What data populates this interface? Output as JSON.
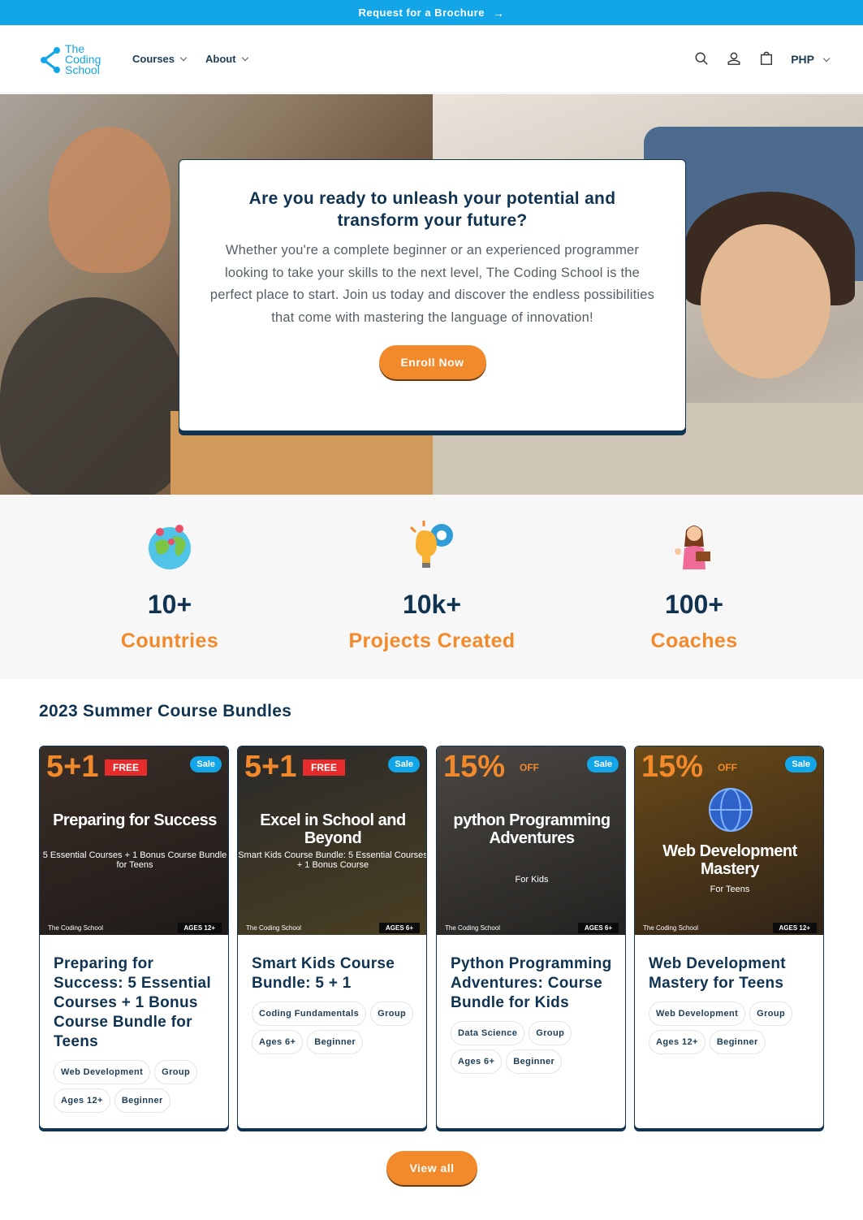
{
  "announcement": {
    "text": "Request for a Brochure",
    "arrow": "→"
  },
  "header": {
    "logo": {
      "line1": "The",
      "line2": "Coding",
      "line3": "School"
    },
    "nav": [
      {
        "label": "Courses"
      },
      {
        "label": "About"
      }
    ],
    "icons": [
      "search-icon",
      "account-icon",
      "cart-icon"
    ],
    "currency": "PHP"
  },
  "hero": {
    "title": "Are you ready to unleash your potential and transform your future?",
    "text": "Whether you're a complete beginner or an experienced programmer looking to take your skills to the next level, The Coding School is the perfect place to start. Join us today and discover the endless possibilities that come with mastering the language of innovation!",
    "button": "Enroll Now"
  },
  "stats": [
    {
      "icon": "globe-icon",
      "value": "10+",
      "label": "Countries"
    },
    {
      "icon": "lightbulb-gear-icon",
      "value": "10k+",
      "label": "Projects Created"
    },
    {
      "icon": "coach-icon",
      "value": "100+",
      "label": "Coaches"
    }
  ],
  "bundles": {
    "title": "2023 Summer Course Bundles",
    "cards": [
      {
        "badge": "5+1",
        "free": "FREE",
        "sale": "Sale",
        "img_title": "Preparing for Success",
        "img_sub": "5 Essential Courses + 1 Bonus Course Bundle for Teens",
        "footer_brand": "The Coding School",
        "ages_badge": "AGES 12+",
        "title": "Preparing for Success: 5 Essential Courses + 1 Bonus Course Bundle for Teens",
        "tags": [
          "Web Development",
          "Group",
          "Ages 12+",
          "Beginner"
        ],
        "colors": [
          "#2b2320",
          "#5a3f2e"
        ]
      },
      {
        "badge": "5+1",
        "free": "FREE",
        "sale": "Sale",
        "img_title": "Excel in School and Beyond",
        "img_sub": "Smart Kids Course Bundle: 5 Essential Courses + 1 Bonus Course",
        "footer_brand": "The Coding School",
        "ages_badge": "AGES 6+",
        "title": "Smart Kids Course Bundle: 5 + 1",
        "tags": [
          "Coding Fundamentals",
          "Group",
          "Ages 6+",
          "Beginner"
        ],
        "colors": [
          "#2a2a2a",
          "#6b5a2a"
        ]
      },
      {
        "badge": "15%",
        "free": "OFF",
        "sale": "Sale",
        "img_title": "python Programming Adventures",
        "img_sub": "For Kids",
        "footer_brand": "The Coding School",
        "ages_badge": "AGES 6+",
        "title": "Python Programming Adventures: Course Bundle for Kids",
        "tags": [
          "Data Science",
          "Group",
          "Ages 6+",
          "Beginner"
        ],
        "colors": [
          "#4a4744",
          "#2c2a28"
        ]
      },
      {
        "badge": "15%",
        "free": "OFF",
        "sale": "Sale",
        "img_title": "Web Development Mastery",
        "img_sub": "For Teens",
        "footer_brand": "The Coding School",
        "ages_badge": "AGES 12+",
        "title": "Web Development Mastery for Teens",
        "tags": [
          "Web Development",
          "Group",
          "Ages 12+",
          "Beginner"
        ],
        "colors": [
          "#5a3a10",
          "#3a2a18"
        ]
      }
    ],
    "view_all": "View all"
  },
  "colors": {
    "accent_blue": "#12a5e8",
    "accent_orange": "#f28a2c",
    "navy": "#0f3350"
  }
}
